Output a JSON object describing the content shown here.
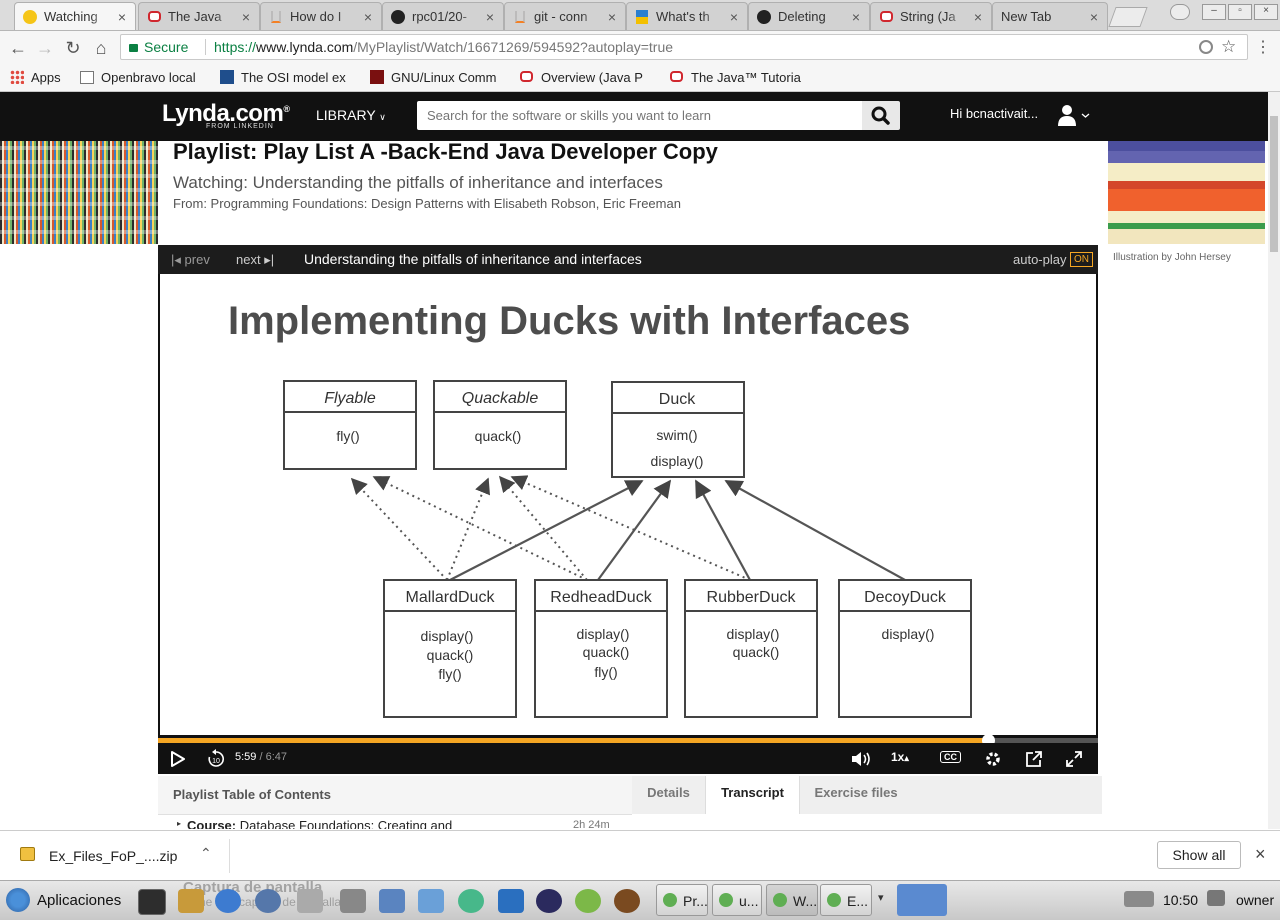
{
  "browser": {
    "tabs": [
      {
        "title": "Watching",
        "icon": "lynda-favicon",
        "active": true
      },
      {
        "title": "The Java",
        "icon": "oracle-favicon"
      },
      {
        "title": "How do I",
        "icon": "stackoverflow-favicon"
      },
      {
        "title": "rpc01/20-",
        "icon": "github-favicon"
      },
      {
        "title": "git - conn",
        "icon": "stackoverflow-favicon"
      },
      {
        "title": "What's th",
        "icon": "medium-favicon"
      },
      {
        "title": "Deleting",
        "icon": "github-favicon"
      },
      {
        "title": "String (Ja",
        "icon": "oracle-favicon"
      },
      {
        "title": "New Tab",
        "icon": "none"
      }
    ],
    "close_glyph": "×",
    "secure_label": "Secure",
    "url": {
      "scheme": "https://",
      "host": "www.lynda.com",
      "path": "/MyPlaylist/Watch/16671269/594592?autoplay=true"
    },
    "bookmarks": [
      {
        "label": "Apps",
        "icon": "apps-grid-icon"
      },
      {
        "label": "Openbravo local",
        "icon": "page-icon"
      },
      {
        "label": "The OSI model ex",
        "icon": "nw-icon"
      },
      {
        "label": "GNU/Linux Comm",
        "icon": "gnu-icon"
      },
      {
        "label": "Overview (Java P",
        "icon": "oracle-favicon"
      },
      {
        "label": "The Java™ Tutoria",
        "icon": "oracle-favicon"
      }
    ]
  },
  "site": {
    "logo": "Lynda.com",
    "logo_mark": "®",
    "logo_sub": "FROM LINKEDIN",
    "library_label": "LIBRARY",
    "search_placeholder": "Search for the software or skills you want to learn",
    "greeting": "Hi bcnactivait..."
  },
  "page": {
    "title": "Playlist: Play List A -Back-End Java Developer Copy",
    "watching": "Watching: Understanding the pitfalls of inheritance and interfaces",
    "from": "From: Programming Foundations: Design Patterns with Elisabeth Robson, Eric Freeman",
    "illustration_credit": "Illustration by John Hersey"
  },
  "player": {
    "prev_label": "prev",
    "next_label": "next",
    "video_title": "Understanding the pitfalls of inheritance and interfaces",
    "autoplay_label": "auto-play",
    "autoplay_state": "ON",
    "current_time": "5:59",
    "time_separator": "/",
    "duration": "6:47",
    "progress_fraction": 0.883,
    "speed_label": "1x",
    "speed_arrow": "▴",
    "cc_label": "CC",
    "accent_color": "#f5a623"
  },
  "slide": {
    "title": "Implementing Ducks with Interfaces",
    "interfaces": [
      {
        "name": "Flyable",
        "methods": [
          "fly()"
        ]
      },
      {
        "name": "Quackable",
        "methods": [
          "quack()"
        ]
      }
    ],
    "superclass": {
      "name": "Duck",
      "methods": [
        "swim()",
        "display()"
      ]
    },
    "subclasses": [
      {
        "name": "MallardDuck",
        "methods": [
          "display()",
          "quack()",
          "fly()"
        ]
      },
      {
        "name": "RedheadDuck",
        "methods": [
          "display()",
          "quack()",
          "fly()"
        ]
      },
      {
        "name": "RubberDuck",
        "methods": [
          "display()",
          "quack()"
        ]
      },
      {
        "name": "DecoyDuck",
        "methods": [
          "display()"
        ]
      }
    ]
  },
  "lower": {
    "toc_title": "Playlist Table of Contents",
    "tabs": [
      "Details",
      "Transcript",
      "Exercise files"
    ],
    "selected_tab": "Transcript",
    "course_prefix": "Course:",
    "course_title": "Database Foundations: Creating and",
    "course_duration": "2h 24m"
  },
  "download": {
    "filename": "Ex_Files_FoP_....zip",
    "show_all": "Show all"
  },
  "taskbar": {
    "start_label": "Aplicaciones",
    "ghost_title": "Captura de pantalla",
    "ghost_sub": "Tome una captura de pantalla",
    "windows": [
      {
        "label": "Pr..."
      },
      {
        "label": "u..."
      },
      {
        "label": "W..."
      },
      {
        "label": "E..."
      }
    ],
    "clock": "10:50",
    "user": "owner"
  }
}
